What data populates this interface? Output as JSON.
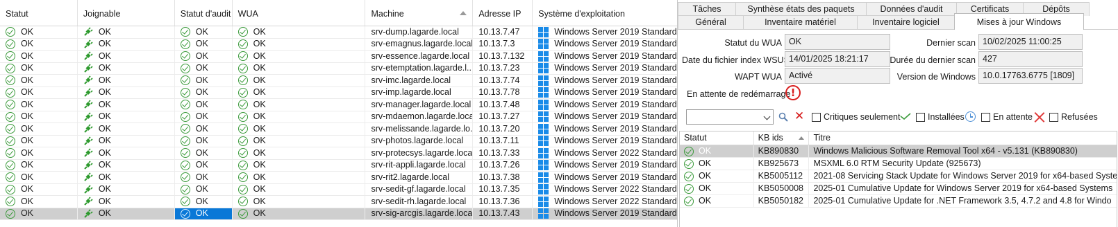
{
  "machines_grid": {
    "columns": [
      "Statut",
      "Joignable",
      "Statut d'audit",
      "WUA",
      "Machine",
      "Adresse IP",
      "Système d'exploitation"
    ],
    "sorted_column": "Machine",
    "rows": [
      {
        "statut": "OK",
        "joignable": "OK",
        "audit": "OK",
        "wua": "OK",
        "machine": "srv-dump.lagarde.local",
        "ip": "10.13.7.47",
        "os": "Windows Server 2019 Standard"
      },
      {
        "statut": "OK",
        "joignable": "OK",
        "audit": "OK",
        "wua": "OK",
        "machine": "srv-emagnus.lagarde.local",
        "ip": "10.13.7.3",
        "os": "Windows Server 2019 Standard"
      },
      {
        "statut": "OK",
        "joignable": "OK",
        "audit": "OK",
        "wua": "OK",
        "machine": "srv-essence.lagarde.local",
        "ip": "10.13.7.132",
        "os": "Windows Server 2019 Standard"
      },
      {
        "statut": "OK",
        "joignable": "OK",
        "audit": "OK",
        "wua": "OK",
        "machine": "srv-etemptation.lagarde.l...",
        "ip": "10.13.7.23",
        "os": "Windows Server 2019 Standard"
      },
      {
        "statut": "OK",
        "joignable": "OK",
        "audit": "OK",
        "wua": "OK",
        "machine": "srv-imc.lagarde.local",
        "ip": "10.13.7.74",
        "os": "Windows Server 2019 Standard"
      },
      {
        "statut": "OK",
        "joignable": "OK",
        "audit": "OK",
        "wua": "OK",
        "machine": "srv-imp.lagarde.local",
        "ip": "10.13.7.78",
        "os": "Windows Server 2019 Standard"
      },
      {
        "statut": "OK",
        "joignable": "OK",
        "audit": "OK",
        "wua": "OK",
        "machine": "srv-manager.lagarde.local",
        "ip": "10.13.7.48",
        "os": "Windows Server 2019 Standard"
      },
      {
        "statut": "OK",
        "joignable": "OK",
        "audit": "OK",
        "wua": "OK",
        "machine": "srv-mdaemon.lagarde.local",
        "ip": "10.13.7.27",
        "os": "Windows Server 2019 Standard"
      },
      {
        "statut": "OK",
        "joignable": "OK",
        "audit": "OK",
        "wua": "OK",
        "machine": "srv-melissande.lagarde.lo...",
        "ip": "10.13.7.20",
        "os": "Windows Server 2019 Standard"
      },
      {
        "statut": "OK",
        "joignable": "OK",
        "audit": "OK",
        "wua": "OK",
        "machine": "srv-photos.lagarde.local",
        "ip": "10.13.7.11",
        "os": "Windows Server 2019 Standard"
      },
      {
        "statut": "OK",
        "joignable": "OK",
        "audit": "OK",
        "wua": "OK",
        "machine": "srv-protecsys.lagarde.local",
        "ip": "10.13.7.33",
        "os": "Windows Server 2022 Standard"
      },
      {
        "statut": "OK",
        "joignable": "OK",
        "audit": "OK",
        "wua": "OK",
        "machine": "srv-rit-appli.lagarde.local",
        "ip": "10.13.7.26",
        "os": "Windows Server 2019 Standard"
      },
      {
        "statut": "OK",
        "joignable": "OK",
        "audit": "OK",
        "wua": "OK",
        "machine": "srv-rit2.lagarde.local",
        "ip": "10.13.7.38",
        "os": "Windows Server 2019 Standard"
      },
      {
        "statut": "OK",
        "joignable": "OK",
        "audit": "OK",
        "wua": "OK",
        "machine": "srv-sedit-gf.lagarde.local",
        "ip": "10.13.7.35",
        "os": "Windows Server 2022 Standard"
      },
      {
        "statut": "OK",
        "joignable": "OK",
        "audit": "OK",
        "wua": "OK",
        "machine": "srv-sedit-rh.lagarde.local",
        "ip": "10.13.7.36",
        "os": "Windows Server 2022 Standard"
      },
      {
        "statut": "OK",
        "joignable": "OK",
        "audit": "OK",
        "wua": "OK",
        "machine": "srv-sig-arcgis.lagarde.local",
        "ip": "10.13.7.43",
        "os": "Windows Server 2019 Standard",
        "selected": true
      }
    ]
  },
  "tabs": {
    "row1": [
      "Tâches",
      "Synthèse états des paquets",
      "Données d'audit",
      "Certificats",
      "Dépôts"
    ],
    "row2": [
      "Général",
      "Inventaire matériel",
      "Inventaire logiciel",
      "Mises à jour Windows"
    ],
    "active": "Mises à jour Windows"
  },
  "wu_panel": {
    "statut_wua_label": "Statut du WUA",
    "statut_wua_value": "OK",
    "dernier_scan_label": "Dernier scan",
    "dernier_scan_value": "10/02/2025 11:00:25",
    "date_index_label": "Date du fichier index WSUS",
    "date_index_value": "14/01/2025 18:21:17",
    "duree_scan_label": "Durée du dernier scan",
    "duree_scan_value": "427",
    "wapt_wua_label": "WAPT WUA",
    "wapt_wua_value": "Activé",
    "version_windows_label": "Version de Windows",
    "version_windows_value": "10.0.17763.6775 [1809]",
    "reboot_label": "En attente de redémarrage",
    "reboot_icon_glyph": "!"
  },
  "filters": {
    "select_value": "",
    "critiques_label": "Critiques seulement",
    "installees_label": "Installées",
    "en_attente_label": "En attente",
    "refusees_label": "Refusées"
  },
  "updates_grid": {
    "columns": [
      "Statut",
      "KB ids",
      "Titre"
    ],
    "rows": [
      {
        "statut": "OK",
        "kb": "KB890830",
        "titre": "Windows Malicious Software Removal Tool x64 - v5.131 (KB890830)",
        "selected": true
      },
      {
        "statut": "OK",
        "kb": "KB925673",
        "titre": "MSXML 6.0 RTM Security Update  (925673)"
      },
      {
        "statut": "OK",
        "kb": "KB5005112",
        "titre": "2021-08 Servicing Stack Update for Windows Server 2019 for x64-based Syste"
      },
      {
        "statut": "OK",
        "kb": "KB5050008",
        "titre": "2025-01 Cumulative Update for Windows Server 2019 for x64-based Systems"
      },
      {
        "statut": "OK",
        "kb": "KB5050182",
        "titre": "2025-01 Cumulative Update for .NET Framework 3.5, 4.7.2 and 4.8 for Windo"
      }
    ]
  },
  "colors": {
    "ok_green": "#3a9a3a",
    "plug_green": "#2e9a2e",
    "windows_blue": "#1a8be8",
    "selection_blue": "#0a78d7",
    "selection_gray": "#cfcfcf",
    "error_red": "#d81e1e"
  }
}
